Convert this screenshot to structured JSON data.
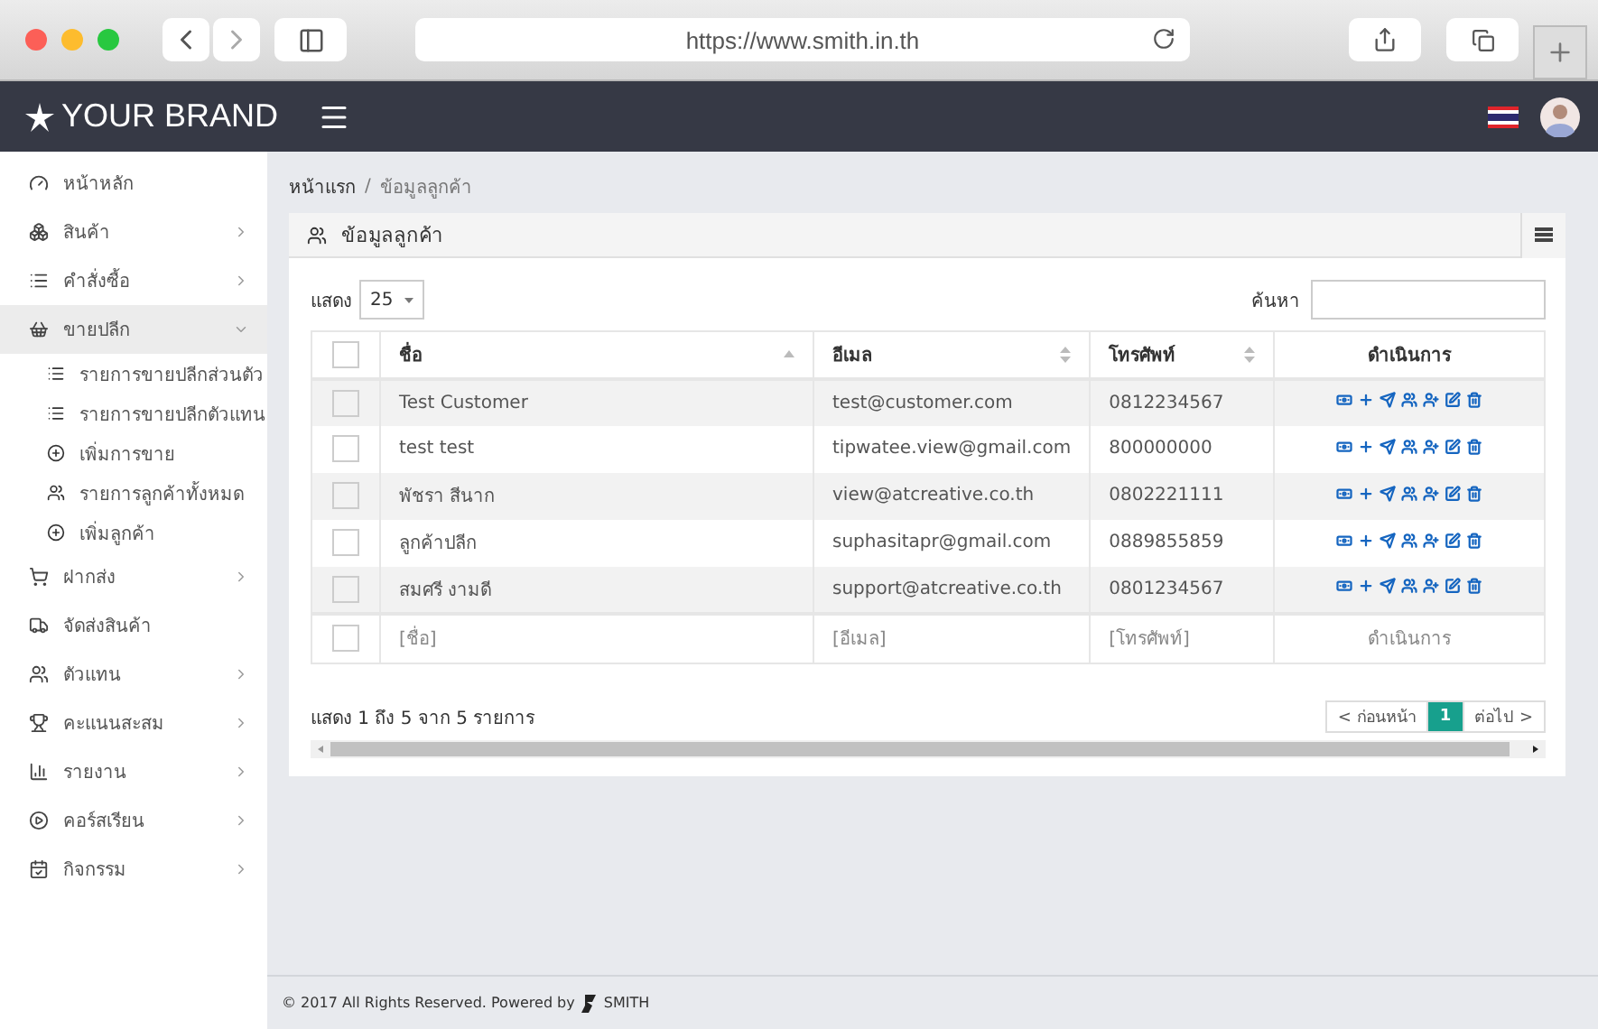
{
  "browser": {
    "url": "https://www.smith.in.th"
  },
  "navbar": {
    "brand": "YOUR BRAND"
  },
  "sidebar": {
    "items": [
      {
        "label": "หน้าหลัก",
        "has_submenu": false,
        "selected": false
      },
      {
        "label": "สินค้า",
        "has_submenu": true,
        "expanded": false,
        "selected": false
      },
      {
        "label": "คำสั่งซื้อ",
        "has_submenu": true,
        "expanded": false,
        "selected": false
      },
      {
        "label": "ขายปลีก",
        "has_submenu": true,
        "expanded": true,
        "selected": true,
        "children": [
          {
            "label": "รายการขายปลีกส่วนตัว"
          },
          {
            "label": "รายการขายปลีกตัวแทน"
          },
          {
            "label": "เพิ่มการขาย"
          },
          {
            "label": "รายการลูกค้าทั้งหมด"
          },
          {
            "label": "เพิ่มลูกค้า"
          }
        ]
      },
      {
        "label": "ฝากส่ง",
        "has_submenu": true,
        "expanded": false,
        "selected": false
      },
      {
        "label": "จัดส่งสินค้า",
        "has_submenu": false,
        "selected": false
      },
      {
        "label": "ตัวแทน",
        "has_submenu": true,
        "expanded": false,
        "selected": false
      },
      {
        "label": "คะแนนสะสม",
        "has_submenu": true,
        "expanded": false,
        "selected": false
      },
      {
        "label": "รายงาน",
        "has_submenu": true,
        "expanded": false,
        "selected": false
      },
      {
        "label": "คอร์สเรียน",
        "has_submenu": true,
        "expanded": false,
        "selected": false
      },
      {
        "label": "กิจกรรม",
        "has_submenu": true,
        "expanded": false,
        "selected": false
      }
    ]
  },
  "breadcrumb": {
    "items": [
      "หน้าแรก",
      "ข้อมูลลูกค้า"
    ],
    "separator": "/"
  },
  "panel": {
    "title": "ข้อมูลลูกค้า",
    "length_label": "แสดง",
    "length_value": "25",
    "search_label": "ค้นหา",
    "table": {
      "select_all_checked": false,
      "columns": [
        {
          "label": "ชื่อ",
          "sortable": true,
          "sorted": true
        },
        {
          "label": "อีเมล",
          "sortable": true,
          "sorted": false
        },
        {
          "label": "โทรศัพท์",
          "sortable": true,
          "sorted": false
        },
        {
          "label": "ดำเนินการ",
          "sortable": false
        }
      ],
      "rows": [
        {
          "checked": false,
          "name": "Test Customer",
          "email": "test@customer.com",
          "phone": "0812234567"
        },
        {
          "checked": false,
          "name": "test test",
          "email": "tipwatee.view@gmail.com",
          "phone": "800000000"
        },
        {
          "checked": false,
          "name": "พัชรา สีนาก",
          "email": "view@atcreative.co.th",
          "phone": "0802221111"
        },
        {
          "checked": false,
          "name": "ลูกค้าปลีก",
          "email": "suphasitapr@gmail.com",
          "phone": "0889855859"
        },
        {
          "checked": false,
          "name": "สมศรี งามดี",
          "email": "support@atcreative.co.th",
          "phone": "0801234567"
        }
      ],
      "filter_row": {
        "checked": false,
        "name": "[ชื่อ]",
        "email": "[อีเมล]",
        "phone": "[โทรศัพท์]",
        "action": "ดำเนินการ"
      }
    },
    "info": "แสดง 1 ถึง 5 จาก 5 รายการ",
    "pagination": [
      {
        "label": "< ก่อนหน้า",
        "selected": false
      },
      {
        "label": "1",
        "selected": true
      },
      {
        "label": "ต่อไป >",
        "selected": false
      }
    ]
  },
  "footer": {
    "text": "© 2017 All Rights Reserved. Powered by",
    "brand": "SMITH"
  }
}
